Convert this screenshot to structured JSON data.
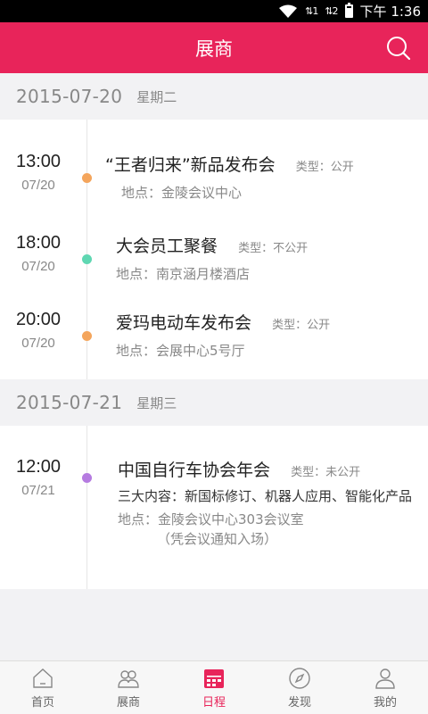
{
  "status": {
    "time": "下午 1:36",
    "sim1": "⇅1",
    "sim2": "⇅2"
  },
  "header": {
    "title": "展商"
  },
  "days": [
    {
      "date": "2015-07-20",
      "weekday": "星期二",
      "events": [
        {
          "time": "13:00",
          "date": "07/20",
          "name": "“王者归来”新品发布会",
          "type": "类型：公开",
          "location": "地点：金陵会议中心",
          "dot": "#f4a55c"
        },
        {
          "time": "18:00",
          "date": "07/20",
          "name": "大会员工聚餐",
          "type": "类型：不公开",
          "location": "地点：南京涵月楼酒店",
          "dot": "#5fd7b2"
        },
        {
          "time": "20:00",
          "date": "07/20",
          "name": "爱玛电动车发布会",
          "type": "类型：公开",
          "location": "地点：会展中心5号厅",
          "dot": "#f4a55c"
        }
      ]
    },
    {
      "date": "2015-07-21",
      "weekday": "星期三",
      "events": [
        {
          "time": "12:00",
          "date": "07/21",
          "name": "中国自行车协会年会",
          "type": "类型：未公开",
          "content_label": "三大内容：",
          "content": "新国标修订、机器人应用、智能化产品",
          "location": "地点：金陵会议中心303会议室",
          "location_note": "（凭会议通知入场）",
          "dot": "#b57be0"
        }
      ]
    }
  ],
  "tabs": [
    {
      "label": "首页",
      "icon": "home-icon"
    },
    {
      "label": "展商",
      "icon": "people-icon"
    },
    {
      "label": "日程",
      "icon": "calendar-icon",
      "active": true
    },
    {
      "label": "发现",
      "icon": "compass-icon"
    },
    {
      "label": "我的",
      "icon": "user-icon"
    }
  ],
  "colors": {
    "accent": "#e8245a"
  }
}
